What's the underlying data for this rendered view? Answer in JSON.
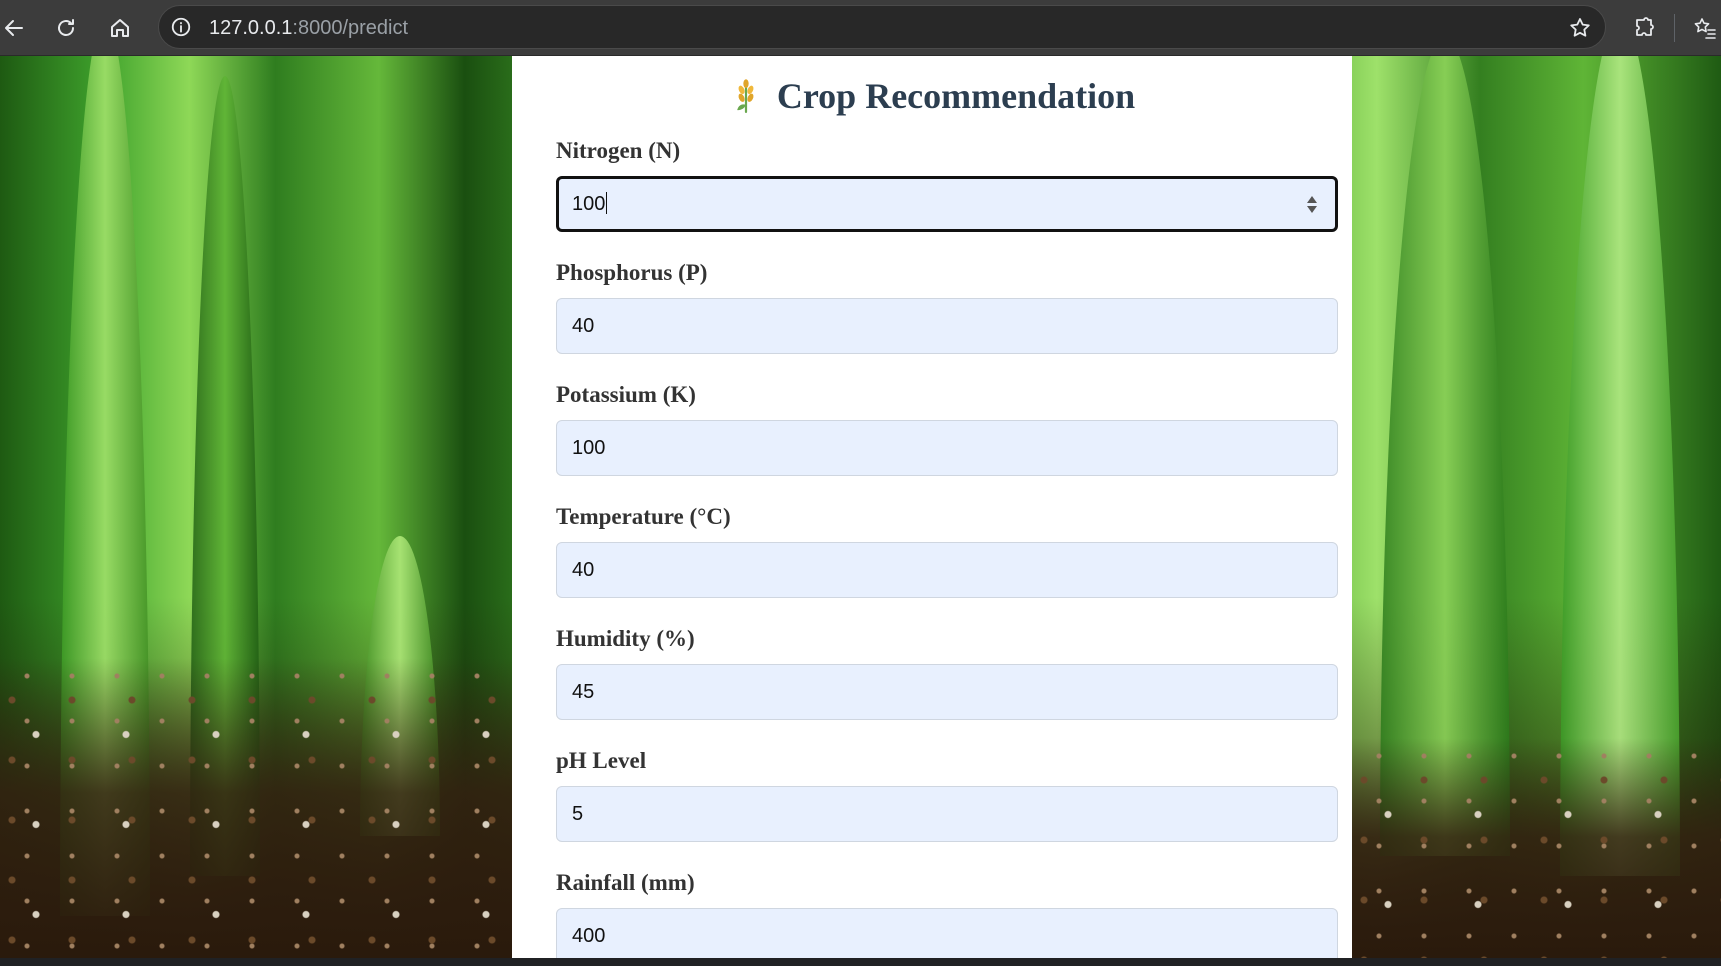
{
  "browser": {
    "url_host": "127.0.0.1",
    "url_path": ":8000/predict"
  },
  "page": {
    "title": "Crop Recommendation",
    "title_icon": "wheat-icon",
    "fields": [
      {
        "label": "Nitrogen (N)",
        "value": "100"
      },
      {
        "label": "Phosphorus (P)",
        "value": "40"
      },
      {
        "label": "Potassium (K)",
        "value": "100"
      },
      {
        "label": "Temperature (°C)",
        "value": "40"
      },
      {
        "label": "Humidity (%)",
        "value": "45"
      },
      {
        "label": "pH Level",
        "value": "5"
      },
      {
        "label": "Rainfall (mm)",
        "value": "400"
      }
    ]
  },
  "colors": {
    "title": "#2c3e50",
    "input_background": "#e8f0fe",
    "focus_border": "#111111"
  }
}
